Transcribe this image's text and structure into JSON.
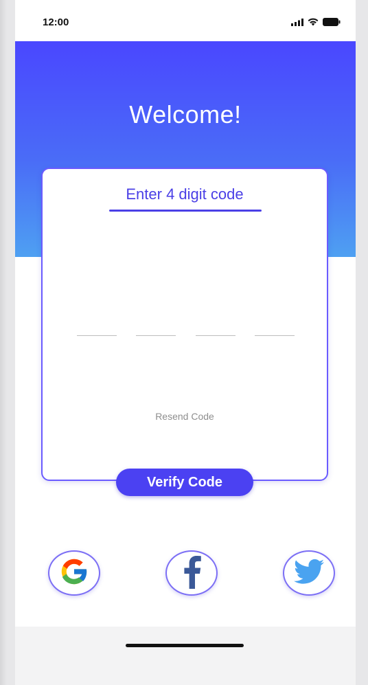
{
  "status_bar": {
    "time": "12:00",
    "signal_icon": "signal-icon",
    "wifi_icon": "wifi-icon",
    "battery_icon": "battery-icon"
  },
  "hero": {
    "title": "Welcome!"
  },
  "card": {
    "title": "Enter 4 digit code",
    "digits": [
      {
        "value": "",
        "placeholder": ""
      },
      {
        "value": "",
        "placeholder": ""
      },
      {
        "value": "",
        "placeholder": ""
      },
      {
        "value": "",
        "placeholder": ""
      }
    ],
    "resend_label": "Resend Code"
  },
  "verify_button": {
    "label": "Verify Code"
  },
  "social": {
    "google_icon": "google-icon",
    "facebook_icon": "facebook-icon",
    "twitter_icon": "twitter-icon"
  },
  "colors": {
    "accent": "#4b41f2",
    "gradient_top": "#4a47ff",
    "gradient_bottom": "#4ea0f2",
    "card_border": "#6a5bff"
  }
}
